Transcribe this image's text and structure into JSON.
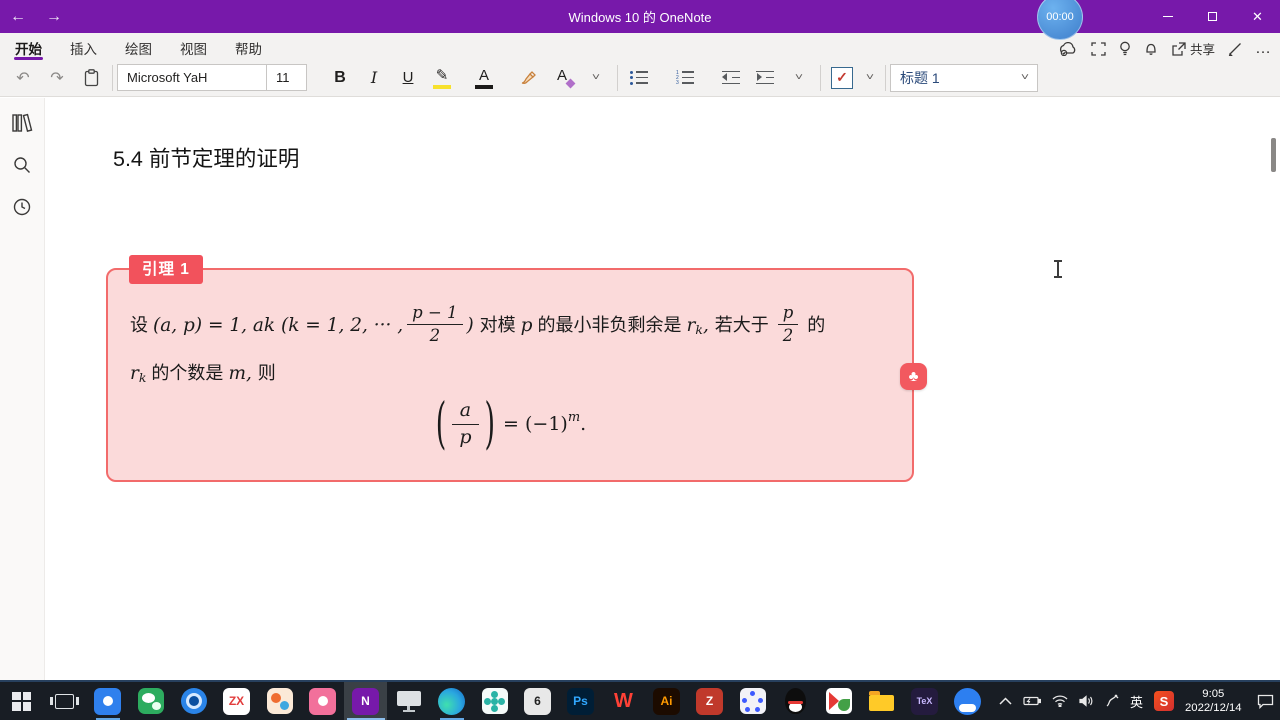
{
  "titlebar": {
    "title": "Windows 10 的 OneNote",
    "timer": "00:00",
    "back_icon": "←",
    "forward_icon": "→",
    "close_icon": "✕"
  },
  "ribbon": {
    "tabs": [
      {
        "label": "开始",
        "active": true
      },
      {
        "label": "插入",
        "active": false
      },
      {
        "label": "绘图",
        "active": false
      },
      {
        "label": "视图",
        "active": false
      },
      {
        "label": "帮助",
        "active": false
      }
    ],
    "share_label": "共享",
    "more_icon": "…"
  },
  "toolbar": {
    "font_name": "Microsoft YaH",
    "font_size": "11",
    "bold": "B",
    "italic": "I",
    "underline": "U",
    "highlight_letter": "✎",
    "fontcolor_letter": "A",
    "clearformat_letter": "A",
    "style_name": "标题 1",
    "check_glyph": "✓",
    "undo_icon": "↶",
    "redo_icon": "↷"
  },
  "sidebar": {
    "icons": [
      "notebooks-icon",
      "search-icon",
      "recent-icon"
    ]
  },
  "page": {
    "heading": "5.4 前节定理的证明"
  },
  "lemma": {
    "label": "引理 1",
    "l1": [
      {
        "k": "cjk",
        "t": "设 "
      },
      {
        "k": "mi",
        "t": "(a, p) = 1, ak (k = 1, 2, ··· ,"
      },
      {
        "k": "frac",
        "num": "p − 1",
        "den": "2"
      },
      {
        "k": "mi",
        "t": ") "
      },
      {
        "k": "cjk",
        "t": "对模 "
      },
      {
        "k": "mi",
        "t": "p"
      },
      {
        "k": "cjk",
        "t": " 的最小非负剩余是 "
      },
      {
        "k": "mi",
        "t": "r"
      },
      {
        "k": "sub",
        "t": "k"
      },
      {
        "k": "mi",
        "t": ", "
      },
      {
        "k": "cjk",
        "t": "若大于 "
      },
      {
        "k": "frac",
        "num": "p",
        "den": "2"
      },
      {
        "k": "cjk",
        "t": " 的"
      }
    ],
    "l2": [
      {
        "k": "mi",
        "t": "r"
      },
      {
        "k": "sub",
        "t": "k"
      },
      {
        "k": "cjk",
        "t": " 的个数是 "
      },
      {
        "k": "mi",
        "t": "m"
      },
      {
        "k": "mi",
        "t": ", "
      },
      {
        "k": "cjk",
        "t": "则"
      }
    ],
    "formula": {
      "lp": "(",
      "num": "a",
      "den": "p",
      "rp": ")",
      "eq": "= (−1)",
      "sup": "m",
      "tail": "."
    }
  },
  "taskbar": {
    "items": [
      {
        "name": "start-button",
        "type": "start"
      },
      {
        "name": "task-view-button",
        "type": "taskview"
      },
      {
        "name": "messenger-app",
        "type": "letter",
        "bg": "#2f80ed",
        "fg": "#ffffff",
        "text": "",
        "dot": true,
        "running": true
      },
      {
        "name": "wechat-app",
        "type": "wechat"
      },
      {
        "name": "dingtalk-app",
        "type": "ring"
      },
      {
        "name": "zx-app",
        "type": "letter",
        "bg": "#ffffff",
        "fg": "#e23c3c",
        "text": "ZX"
      },
      {
        "name": "paint-app",
        "type": "paint"
      },
      {
        "name": "pink-app",
        "type": "letter",
        "bg": "#f2709b",
        "fg": "#ffffff",
        "text": "",
        "dot": true
      },
      {
        "name": "onenote-app",
        "type": "letter",
        "bg": "#7719aa",
        "fg": "#ffffff",
        "text": "N",
        "active": true,
        "running": true
      },
      {
        "name": "remote-desktop-app",
        "type": "monitor"
      },
      {
        "name": "edge-browser",
        "type": "edge",
        "running": true
      },
      {
        "name": "petals-app",
        "type": "petals"
      },
      {
        "name": "sketchpad-app",
        "type": "letter",
        "bg": "#e8e8e8",
        "fg": "#222222",
        "text": "6"
      },
      {
        "name": "photoshop-app",
        "type": "letter",
        "bg": "#001e36",
        "fg": "#31a8ff",
        "text": "Ps"
      },
      {
        "name": "wps-app",
        "type": "letter",
        "bg": "transparent",
        "fg": "#ff4136",
        "text": "W",
        "big": true
      },
      {
        "name": "illustrator-app",
        "type": "letter",
        "bg": "#1c0b00",
        "fg": "#ff9a00",
        "text": "Ai"
      },
      {
        "name": "z-reader-app",
        "type": "letter",
        "bg": "#c0392b",
        "fg": "#ffffff",
        "text": "Z"
      },
      {
        "name": "geogebra-app",
        "type": "geo"
      },
      {
        "name": "qq-app",
        "type": "qq"
      },
      {
        "name": "classroom-app",
        "type": "redgreen"
      },
      {
        "name": "file-explorer",
        "type": "folder"
      },
      {
        "name": "tex-app",
        "type": "letter",
        "bg": "#241b3e",
        "fg": "#c9b8ff",
        "text": "TeX",
        "small": true
      },
      {
        "name": "qq-browser",
        "type": "qqb"
      }
    ],
    "tray": {
      "ime": "英",
      "sogou": "S",
      "time": "9:05",
      "date": "2022/12/14"
    }
  }
}
